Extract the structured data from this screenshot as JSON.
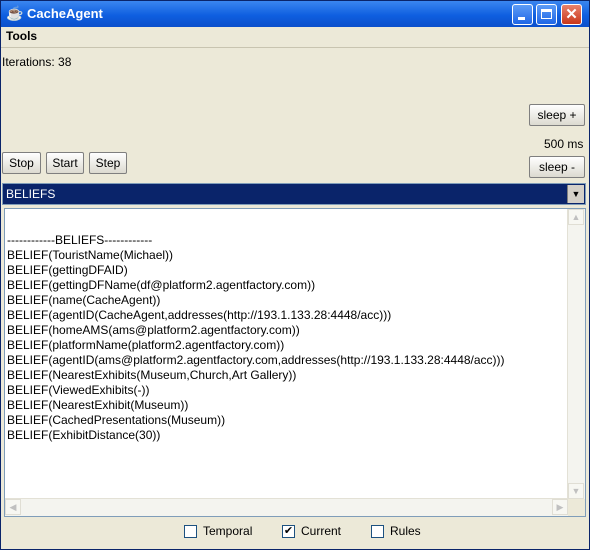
{
  "window": {
    "title": "CacheAgent",
    "icons": {
      "app": "cup-icon",
      "minimize": "minimize-icon",
      "maximize": "maximize-icon",
      "close": "close-icon"
    }
  },
  "menu": {
    "tools": "Tools"
  },
  "status": {
    "iterations": "Iterations: 38"
  },
  "controls": {
    "stop": "Stop",
    "start": "Start",
    "step": "Step",
    "sleep_plus": "sleep +",
    "sleep_value": "500 ms",
    "sleep_minus": "sleep -"
  },
  "view_select": {
    "selected": "BELIEFS"
  },
  "content": {
    "lines": [
      "------------BELIEFS------------",
      "BELIEF(TouristName(Michael))",
      "BELIEF(gettingDFAID)",
      "BELIEF(gettingDFName(df@platform2.agentfactory.com))",
      "BELIEF(name(CacheAgent))",
      "BELIEF(agentID(CacheAgent,addresses(http://193.1.133.28:4448/acc)))",
      "BELIEF(homeAMS(ams@platform2.agentfactory.com))",
      "BELIEF(platformName(platform2.agentfactory.com))",
      "BELIEF(agentID(ams@platform2.agentfactory.com,addresses(http://193.1.133.28:4448/acc)))",
      "BELIEF(NearestExhibits(Museum,Church,Art Gallery))",
      "BELIEF(ViewedExhibits(-))",
      "BELIEF(NearestExhibit(Museum))",
      "BELIEF(CachedPresentations(Museum))",
      "BELIEF(ExhibitDistance(30))"
    ]
  },
  "options": [
    {
      "label": "Temporal",
      "checked": false
    },
    {
      "label": "Current",
      "checked": true
    },
    {
      "label": "Rules",
      "checked": false
    }
  ]
}
